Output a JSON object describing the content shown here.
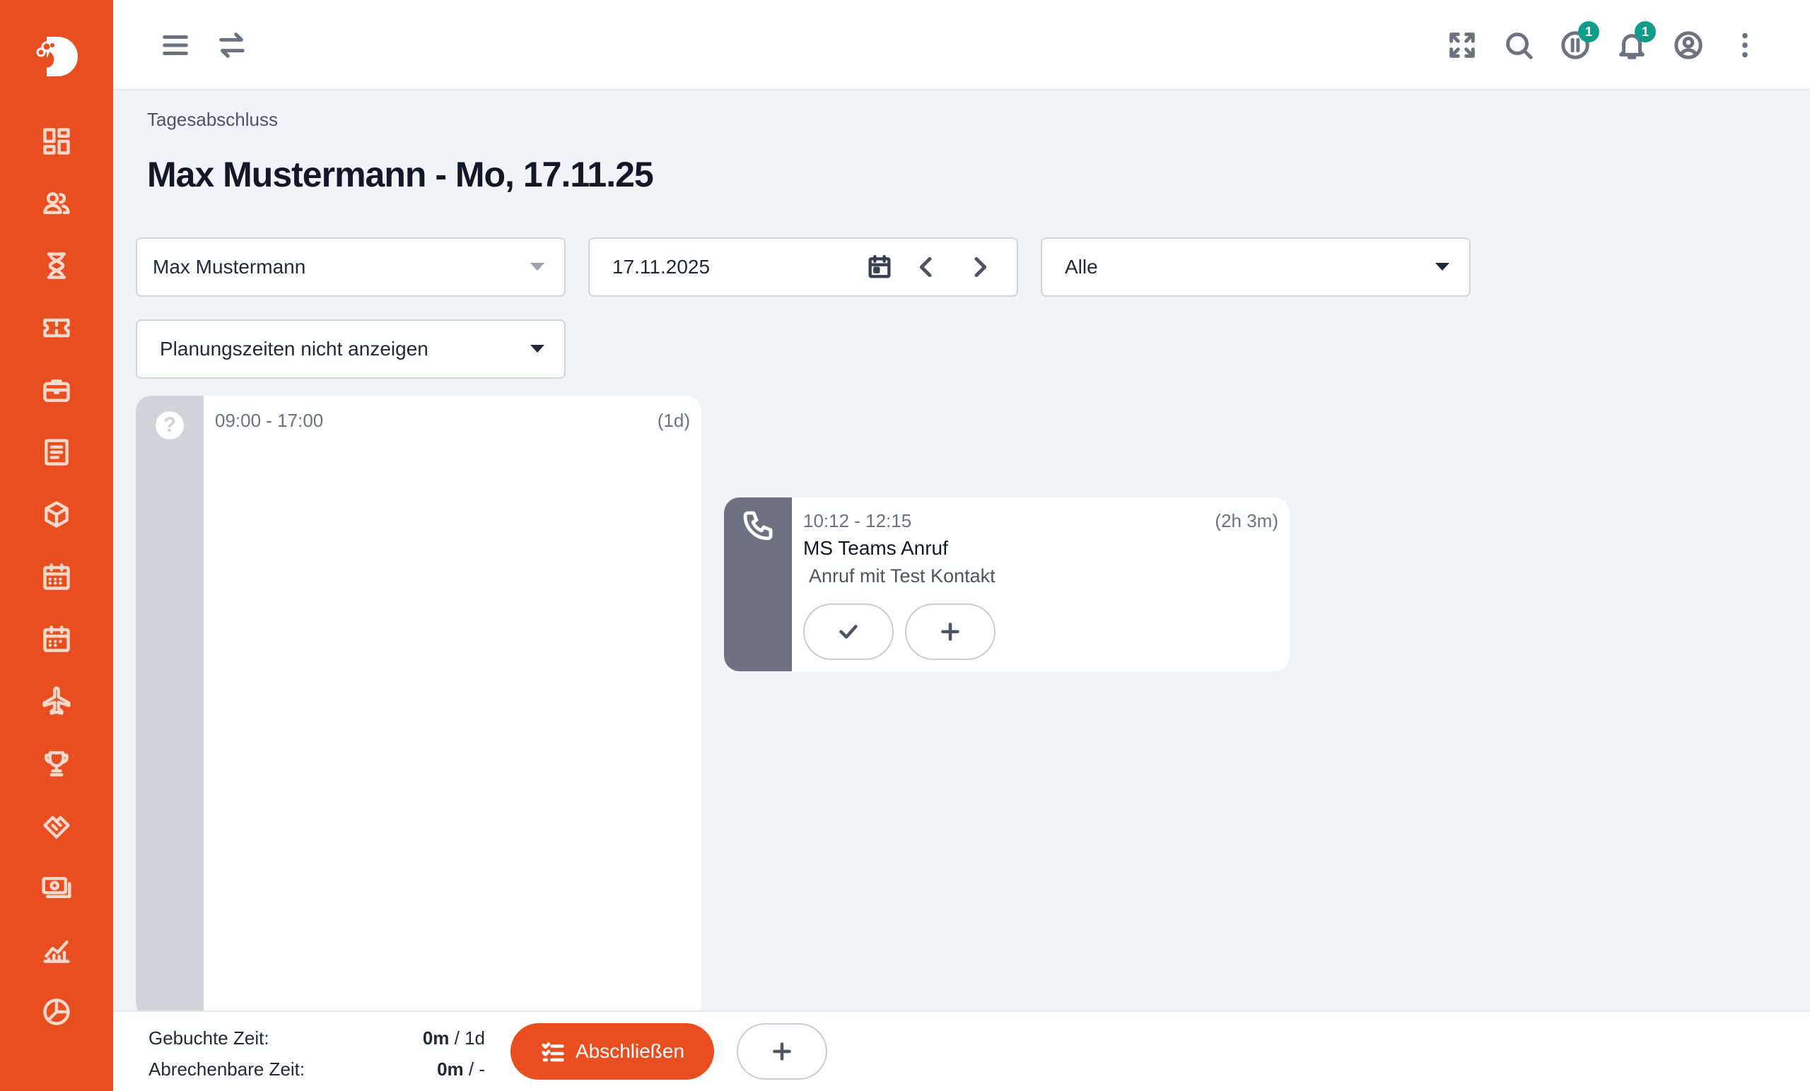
{
  "colors": {
    "brand": "#e84e1f",
    "badge": "#0f9d8a",
    "strip_unplanned": "#cfd3da",
    "strip_call": "#6b7280"
  },
  "sidebar": {
    "icons": [
      "dashboard-icon",
      "contacts-icon",
      "hourglass-icon",
      "ticket-icon",
      "briefcase-icon",
      "document-icon",
      "package-icon",
      "calendar-icon",
      "calendar-alt-icon",
      "airplane-icon",
      "trophy-icon",
      "handshake-icon",
      "money-icon",
      "chart-icon",
      "pie-chart-icon"
    ]
  },
  "topbar": {
    "pause_badge": "1",
    "notification_badge": "1"
  },
  "breadcrumb": "Tagesabschluss",
  "page_title": "Max Mustermann - Mo, 17.11.25",
  "filters": {
    "user": "Max Mustermann",
    "date": "17.11.2025",
    "category": "Alle",
    "planning": "Planungszeiten nicht anzeigen"
  },
  "planned_card": {
    "time": "09:00 - 17:00",
    "duration": "(1d)",
    "help_symbol": "?"
  },
  "event_card": {
    "time": "10:12 - 12:15",
    "duration": "(2h 3m)",
    "title": "MS Teams Anruf",
    "description": "Anruf mit Test Kontakt"
  },
  "footer": {
    "booked_label": "Gebuchte Zeit:",
    "booked_value": "0m",
    "booked_total": " / 1d",
    "billable_label": "Abrechenbare Zeit:",
    "billable_value": "0m",
    "billable_total": " / -",
    "close_button": "Abschließen"
  }
}
